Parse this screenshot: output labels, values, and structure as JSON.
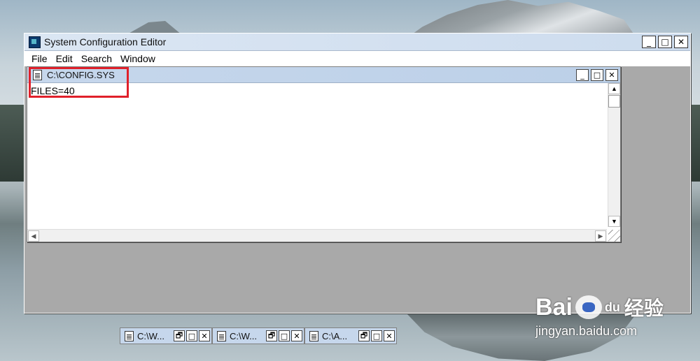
{
  "window": {
    "title": "System Configuration Editor",
    "buttons": {
      "minimize": "_",
      "maximize": "□",
      "close": "✕"
    }
  },
  "menu": [
    "File",
    "Edit",
    "Search",
    "Window"
  ],
  "active_document": {
    "title": "C:\\CONFIG.SYS",
    "content": "FILES=40"
  },
  "minimized_documents": [
    {
      "title": "C:\\W..."
    },
    {
      "title": "C:\\W..."
    },
    {
      "title": "C:\\A..."
    }
  ],
  "child_buttons": {
    "restore": "🗗",
    "maximize": "□",
    "close": "✕"
  },
  "watermark": {
    "brand": "Bai",
    "brand2": "du",
    "cn": "经验",
    "url": "jingyan.baidu.com"
  },
  "colors": {
    "highlight": "#e0202a"
  }
}
